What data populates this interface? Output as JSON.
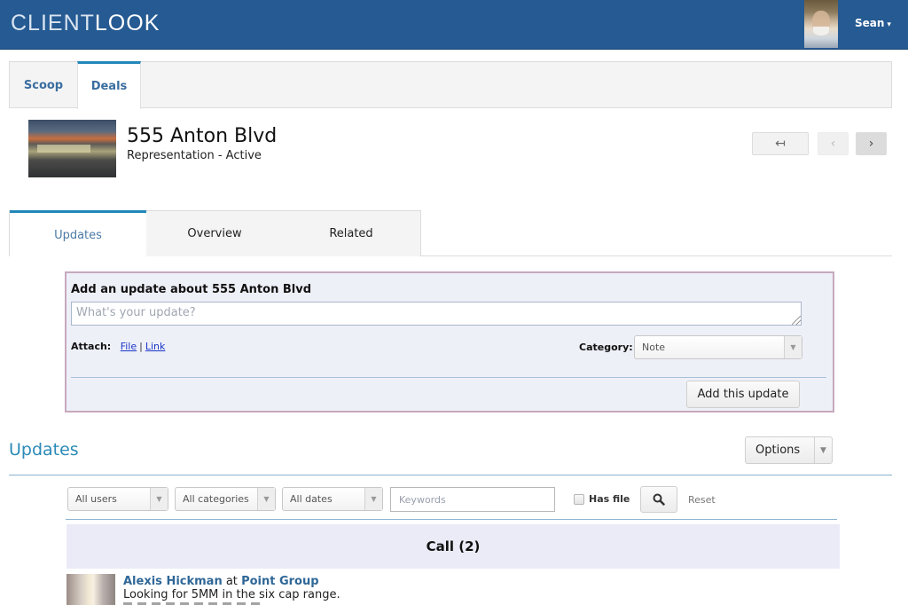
{
  "header": {
    "logo_light": "CLIENT",
    "logo_bold": "LOOK",
    "user_name": "Sean",
    "user_caret": "▾"
  },
  "main_tabs": [
    {
      "label": "Scoop",
      "active": false
    },
    {
      "label": "Deals",
      "active": true
    }
  ],
  "deal": {
    "title": "555 Anton Blvd",
    "subtitle": "Representation - Active"
  },
  "nav": {
    "back_icon": "↤",
    "prev_icon": "‹",
    "next_icon": "›"
  },
  "sub_tabs": [
    {
      "label": "Updates",
      "active": true
    },
    {
      "label": "Overview",
      "active": false
    },
    {
      "label": "Related",
      "active": false
    }
  ],
  "update_form": {
    "title": "Add an update about 555 Anton Blvd",
    "placeholder": "What's your update?",
    "value": "",
    "attach_label": "Attach:",
    "attach_file": "File",
    "attach_sep": "|",
    "attach_link": "Link",
    "category_label": "Category:",
    "category_value": "Note",
    "submit_label": "Add this update"
  },
  "updates": {
    "heading": "Updates",
    "options_label": "Options",
    "filters": {
      "users": "All users",
      "categories": "All categories",
      "dates": "All dates",
      "keywords_placeholder": "Keywords",
      "keywords_value": "",
      "has_file_label": "Has file",
      "has_file_checked": false,
      "reset_label": "Reset"
    },
    "groups": [
      {
        "label": "Call (2)",
        "items": [
          {
            "author": "Alexis Hickman",
            "at": "at",
            "company": "Point Group",
            "text": "Looking for 5MM in the six cap range."
          }
        ]
      }
    ]
  },
  "colors": {
    "topbar": "#255a92",
    "accent": "#2287b8",
    "link": "#2f6797",
    "update_box_bg": "#eef0f8",
    "update_box_border": "#c6a9bd",
    "group_header_bg": "#ebebf7"
  }
}
